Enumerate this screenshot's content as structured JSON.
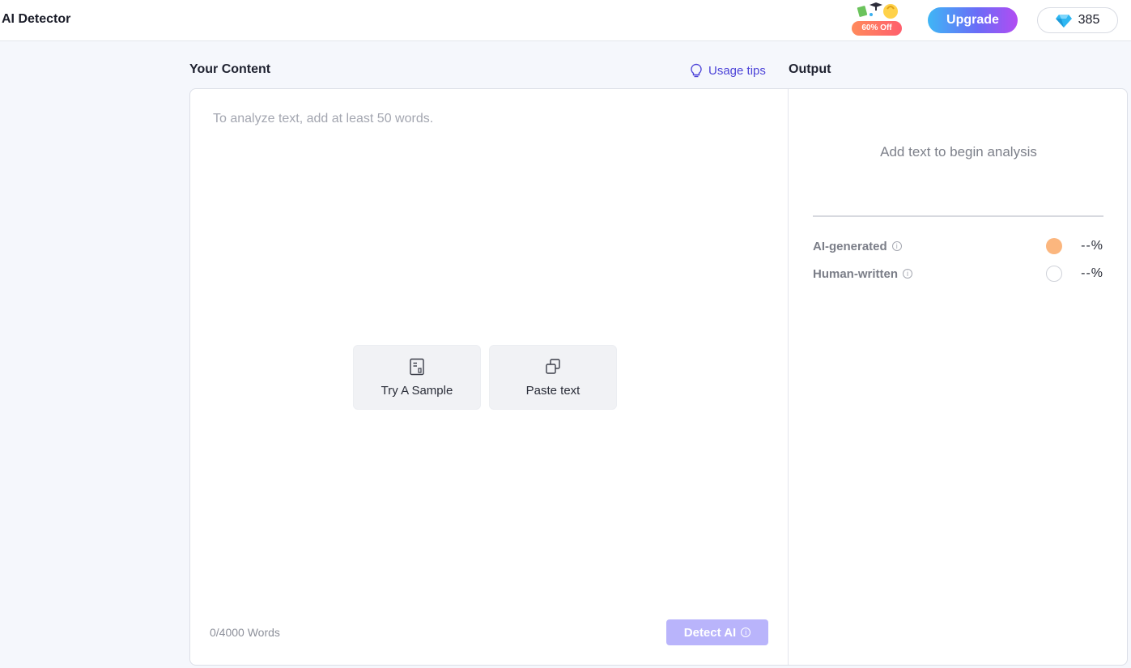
{
  "header": {
    "app_title": "AI Detector",
    "promo_badge": "60% Off",
    "upgrade_label": "Upgrade",
    "credits_count": "385",
    "credits_icon": "diamond-icon"
  },
  "input_section": {
    "title": "Your Content",
    "usage_tips_label": "Usage tips",
    "placeholder": "To analyze text, add at least 50 words.",
    "try_sample_label": "Try A Sample",
    "paste_text_label": "Paste text",
    "word_count": "0/4000 Words",
    "detect_label": "Detect AI"
  },
  "output_section": {
    "title": "Output",
    "empty_message": "Add text to begin analysis",
    "results": [
      {
        "label": "AI-generated",
        "value": "--%",
        "color": "#fbb67e"
      },
      {
        "label": "Human-written",
        "value": "--%",
        "color": "#ffffff"
      }
    ]
  },
  "colors": {
    "accent": "#4c43d8",
    "detect_button": "#b9b4fb"
  }
}
